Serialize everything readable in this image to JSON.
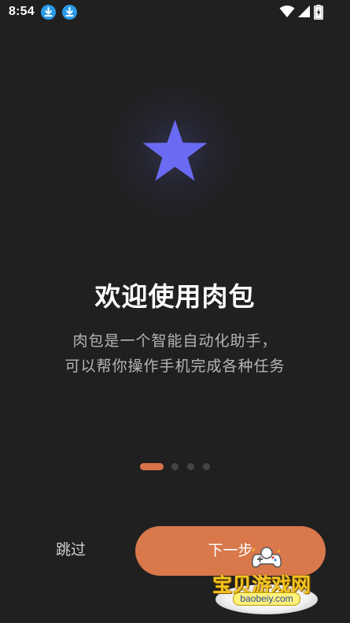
{
  "status_bar": {
    "time": "8:54",
    "notification_icons": [
      "download-icon",
      "download-icon"
    ],
    "system_icons": [
      "wifi-icon",
      "signal-icon",
      "battery-charging-icon"
    ]
  },
  "onboarding": {
    "hero_icon": "star-icon",
    "accent_color": "#6a6af2",
    "title": "欢迎使用肉包",
    "subtitle_lines": [
      "肉包是一个智能自动化助手，",
      "可以帮你操作手机完成各种任务"
    ],
    "page_indicator": {
      "total": 4,
      "current": 1
    }
  },
  "actions": {
    "skip_label": "跳过",
    "next_label": "下一步",
    "primary_color": "#d9784b"
  },
  "watermark": {
    "text": "宝贝游戏网",
    "url": "baobeiy.com"
  }
}
